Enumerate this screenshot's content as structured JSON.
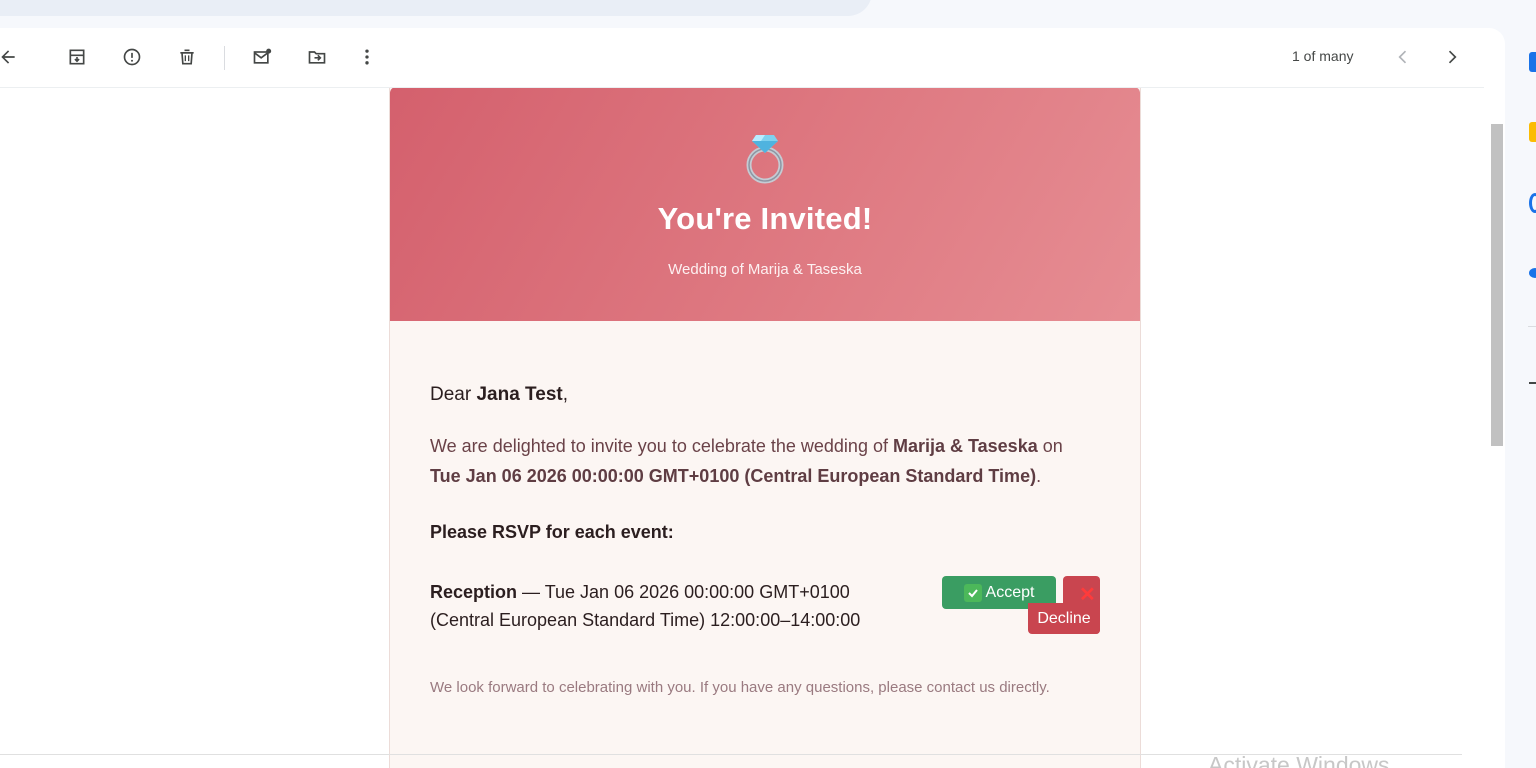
{
  "toolbar": {
    "back_icon": "arrow-left-icon",
    "archive_icon": "archive-icon",
    "spam_icon": "report-spam-icon",
    "delete_icon": "trash-icon",
    "mark_unread_icon": "mark-unread-icon",
    "move_icon": "move-to-folder-icon",
    "more_icon": "more-vertical-icon",
    "pager_text": "1 of many",
    "prev_icon": "chevron-left-icon",
    "next_icon": "chevron-right-icon"
  },
  "email": {
    "hero_icon": "ring-icon",
    "title": "You're Invited!",
    "subtitle": "Wedding of Marija & Taseska",
    "greeting_prefix": "Dear ",
    "recipient": "Jana Test",
    "greeting_suffix": ",",
    "intro_prefix": "We are delighted to invite you to celebrate the wedding of ",
    "couple": "Marija & Taseska",
    "intro_on": " on",
    "date": "Tue Jan 06 2026 00:00:00 GMT+0100 (Central European Standard Time)",
    "intro_end": ".",
    "rsvp_heading": "Please RSVP for each event:",
    "events": [
      {
        "name": "Reception",
        "details": " — Tue Jan 06 2026 00:00:00 GMT+0100 (Central European Standard Time) 12:00:00–14:00:00",
        "accept_label": "Accept",
        "decline_label": "Decline"
      }
    ],
    "footer": "We look forward to celebrating with you. If you have any questions, please contact us directly."
  },
  "watermark": "Activate Windows",
  "colors": {
    "hero_start": "#d4606d",
    "hero_end": "#e68d93",
    "accept": "#3a9d62",
    "decline": "#c9454f",
    "card_bg": "#fcf6f3"
  }
}
